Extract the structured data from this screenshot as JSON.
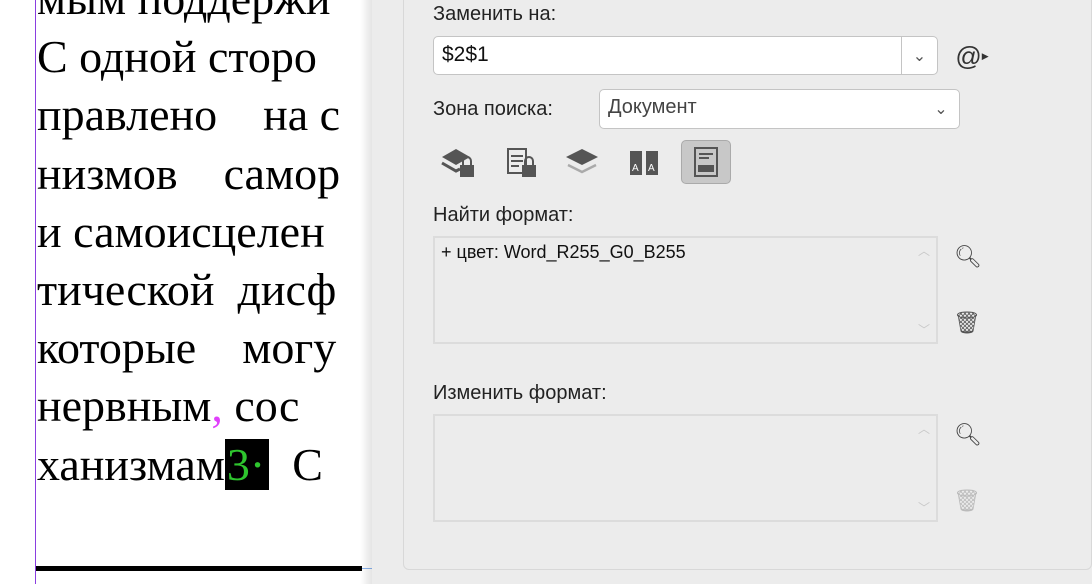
{
  "document": {
    "lines": [
      "мым поддержи",
      "С одной сторо",
      "правлено    на с",
      "низмов    самор",
      "и самоисцелен",
      "тической  дисф",
      "которые    могу",
      "нервным",
      " сос",
      "ханизмам",
      "3·",
      "  С"
    ],
    "comma": ",",
    "highlight_color": "#2ec52e",
    "comma_color": "#e040fb"
  },
  "dialog": {
    "replace_label": "Заменить на:",
    "replace_value": "$2$1",
    "special_chars_icon": "@",
    "search_zone_label": "Зона поиска:",
    "search_zone_value": "Документ",
    "toolbar": [
      "include-locked-layers-icon",
      "include-locked-stories-icon",
      "include-hidden-layers-icon",
      "include-master-pages-icon",
      "include-footnotes-icon"
    ],
    "find_format_label": "Найти формат:",
    "find_format_value": "+ цвет: Word_R255_G0_B255",
    "change_format_label": "Изменить формат:",
    "change_format_value": ""
  }
}
